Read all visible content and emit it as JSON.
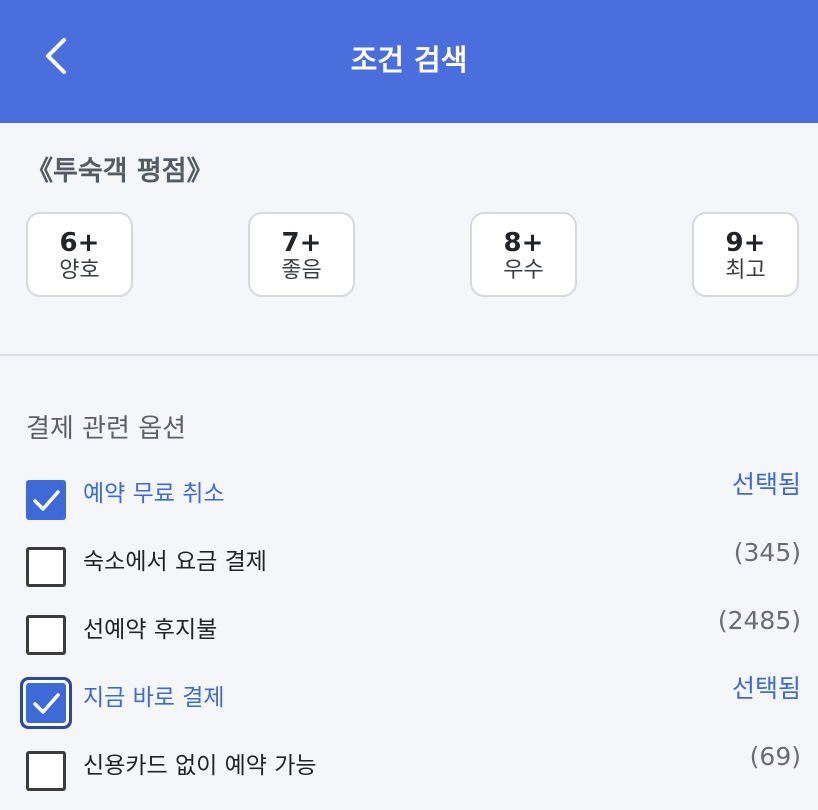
{
  "header": {
    "title": "조건 검색",
    "back_icon": "chevron-left-icon",
    "color": "#4a6fdc"
  },
  "rating": {
    "title": "《투숙객 평점》",
    "options": [
      {
        "score": "6+",
        "label": "양호"
      },
      {
        "score": "7+",
        "label": "좋음"
      },
      {
        "score": "8+",
        "label": "우수"
      },
      {
        "score": "9+",
        "label": "최고"
      }
    ]
  },
  "payment": {
    "title": "결제 관련 옵션",
    "options": [
      {
        "label": "예약 무료 취소",
        "status": "선택됨",
        "checked": true
      },
      {
        "label": "숙소에서 요금 결제",
        "status": "(345)",
        "checked": false
      },
      {
        "label": "선예약 후지불",
        "status": "(2485)",
        "checked": false
      },
      {
        "label": "지금 바로 결제",
        "status": "선택됨",
        "checked": true
      },
      {
        "label": "신용카드 없이 예약 가능",
        "status": "(69)",
        "checked": false
      }
    ]
  },
  "colors": {
    "accent": "#3d6ad6",
    "background": "#f4f6f9"
  }
}
